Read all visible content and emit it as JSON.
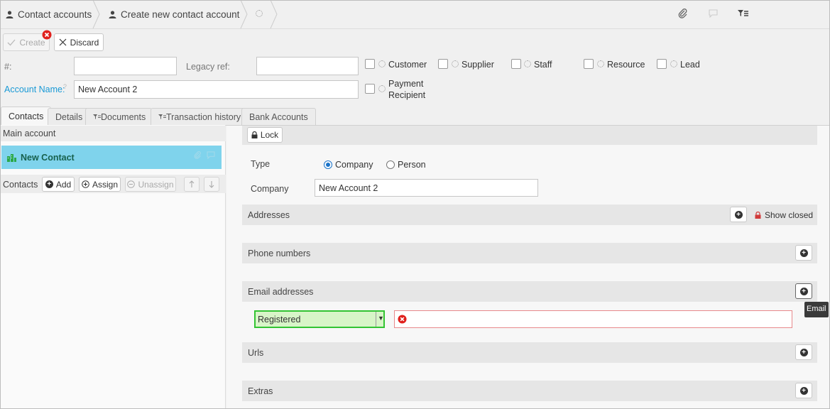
{
  "breadcrumb": {
    "item1": "Contact accounts",
    "item2": "Create new contact account"
  },
  "toolbar": {
    "create": "Create",
    "discard": "Discard"
  },
  "header": {
    "number_label": "#:",
    "legacy_label": "Legacy ref:",
    "account_name_label": "Account Name:",
    "account_name_hint": "?",
    "account_name_value": "New Account 2",
    "roles": {
      "customer": "Customer",
      "supplier": "Supplier",
      "staff": "Staff",
      "resource": "Resource",
      "lead": "Lead",
      "payment1": "Payment",
      "payment2": "Recipient"
    }
  },
  "tabs": {
    "contacts": "Contacts",
    "details": "Details",
    "documents": "Documents",
    "transactions": "Transaction history",
    "bank": "Bank Accounts"
  },
  "left": {
    "main_account": "Main account",
    "new_contact": "New Contact",
    "contacts_label": "Contacts",
    "add": "Add",
    "assign": "Assign",
    "unassign": "Unassign"
  },
  "right": {
    "lock": "Lock",
    "type_label": "Type",
    "type_company": "Company",
    "type_person": "Person",
    "type_selected": "Company",
    "company_label": "Company",
    "company_value": "New Account 2",
    "addresses": "Addresses",
    "show_closed": "Show closed",
    "phone_numbers": "Phone numbers",
    "email_addresses": "Email addresses",
    "email_type": "Registered",
    "email_tooltip": "Email",
    "urls": "Urls",
    "extras": "Extras"
  },
  "colors": {
    "accent": "#1a9ad6",
    "contact_row": "#7fd3ec",
    "green_icon": "#2aa84a",
    "error": "#e0201c",
    "valid_bg": "#d8f5c8",
    "valid_border": "#33c433"
  }
}
